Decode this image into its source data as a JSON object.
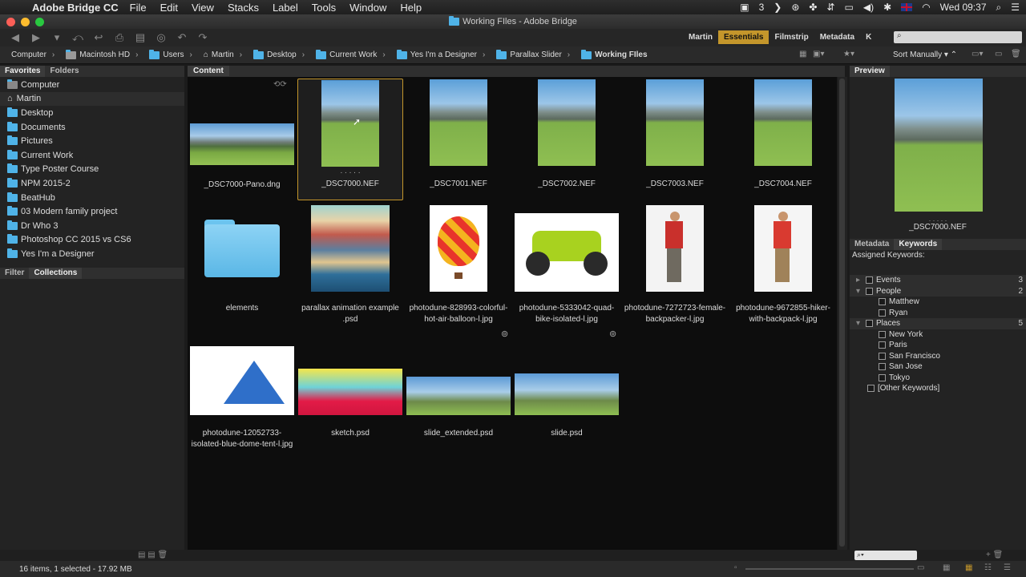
{
  "menubar": {
    "app": "Adobe Bridge CC",
    "items": [
      "File",
      "Edit",
      "View",
      "Stacks",
      "Label",
      "Tools",
      "Window",
      "Help"
    ],
    "badge": "3",
    "clock": "Wed 09:37"
  },
  "window": {
    "title": "Working FIles - Adobe Bridge"
  },
  "workspaces": {
    "items": [
      "Martin",
      "Essentials",
      "Filmstrip",
      "Metadata",
      "K"
    ],
    "active": "Essentials"
  },
  "path": {
    "crumbs": [
      "Computer",
      "Macintosh HD",
      "Users",
      "Martin",
      "Desktop",
      "Current Work",
      "Yes I'm a Designer",
      "Parallax Slider",
      "Working FIles"
    ],
    "sort": "Sort Manually"
  },
  "left": {
    "tabs": [
      "Favorites",
      "Folders"
    ],
    "favorites": [
      "Computer",
      "Martin",
      "Desktop",
      "Documents",
      "Pictures",
      "Current Work",
      "Type Poster Course",
      "NPM 2015-2",
      "BeatHub",
      "03 Modern family project",
      "Dr Who 3",
      "Photoshop CC 2015 vs CS6",
      "Yes I'm a Designer"
    ],
    "lower_tabs": [
      "Filter",
      "Collections"
    ]
  },
  "content": {
    "tab": "Content",
    "rating_dots": ". . . . .",
    "items": [
      {
        "name": "_DSC7000-Pano.dng",
        "kind": "pano"
      },
      {
        "name": "_DSC7000.NEF",
        "kind": "land",
        "selected": true
      },
      {
        "name": "_DSC7001.NEF",
        "kind": "land"
      },
      {
        "name": "_DSC7002.NEF",
        "kind": "land"
      },
      {
        "name": "_DSC7003.NEF",
        "kind": "land"
      },
      {
        "name": "_DSC7004.NEF",
        "kind": "land"
      },
      {
        "name": "elements",
        "kind": "folder"
      },
      {
        "name": "parallax animation example .psd",
        "kind": "town"
      },
      {
        "name": "photodune-828993-colorful-hot-air-balloon-l.jpg",
        "kind": "balloon"
      },
      {
        "name": "photodune-5333042-quad-bike-isolated-l.jpg",
        "kind": "quad"
      },
      {
        "name": "photodune-7272723-female-backpacker-l.jpg",
        "kind": "hiker"
      },
      {
        "name": "photodune-9672855-hiker-with-backpack-l.jpg",
        "kind": "hiker2"
      },
      {
        "name": "photodune-12052733-isolated-blue-dome-tent-l.jpg",
        "kind": "tent"
      },
      {
        "name": "sketch.psd",
        "kind": "sketch"
      },
      {
        "name": "slide_extended.psd",
        "kind": "slide"
      },
      {
        "name": "slide.psd",
        "kind": "slide"
      }
    ]
  },
  "right": {
    "preview_tab": "Preview",
    "preview_caption": "_DSC7000.NEF",
    "tabs": [
      "Metadata",
      "Keywords"
    ],
    "assigned_label": "Assigned Keywords:",
    "keywords": [
      {
        "label": "Events",
        "count": "3",
        "head": true
      },
      {
        "label": "People",
        "count": "2",
        "head": true
      },
      {
        "label": "Matthew",
        "count": "",
        "head": false
      },
      {
        "label": "Ryan",
        "count": "",
        "head": false
      },
      {
        "label": "Places",
        "count": "5",
        "head": true
      },
      {
        "label": "New York",
        "count": "",
        "head": false
      },
      {
        "label": "Paris",
        "count": "",
        "head": false
      },
      {
        "label": "San Francisco",
        "count": "",
        "head": false
      },
      {
        "label": "San Jose",
        "count": "",
        "head": false
      },
      {
        "label": "Tokyo",
        "count": "",
        "head": false
      },
      {
        "label": "[Other Keywords]",
        "count": "",
        "head": false
      }
    ]
  },
  "status": {
    "text": "16 items, 1 selected - 17.92 MB"
  }
}
